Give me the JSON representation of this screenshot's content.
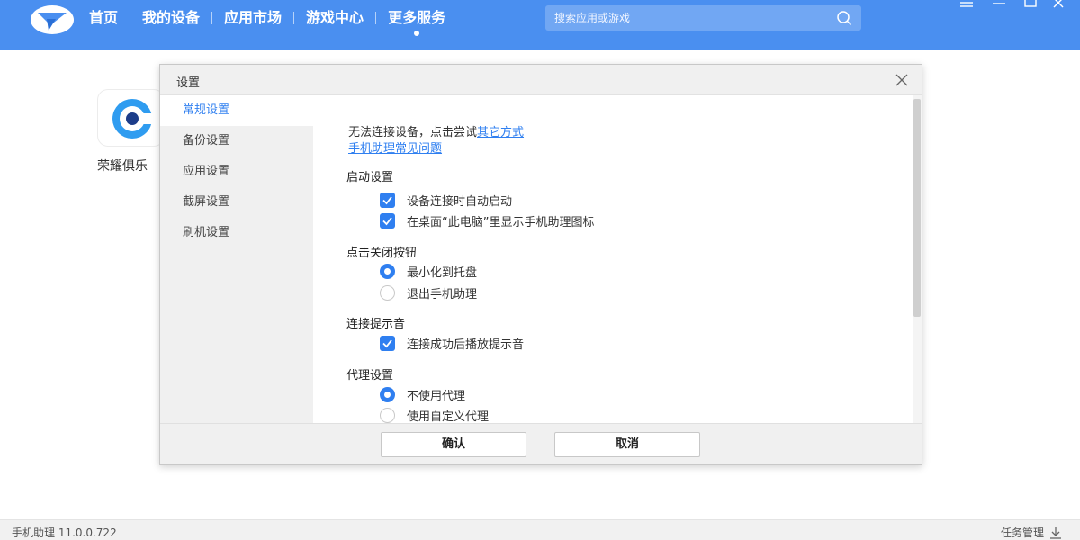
{
  "nav": {
    "items": [
      {
        "label": "首页"
      },
      {
        "label": "我的设备"
      },
      {
        "label": "应用市场"
      },
      {
        "label": "游戏中心"
      },
      {
        "label": "更多服务"
      }
    ],
    "search_placeholder": "搜索应用或游戏"
  },
  "app": {
    "label": "荣耀俱乐"
  },
  "status": {
    "version": "手机助理 11.0.0.722",
    "task_manager": "任务管理"
  },
  "dialog": {
    "title": "设置",
    "sidebar": [
      {
        "label": "常规设置"
      },
      {
        "label": "备份设置"
      },
      {
        "label": "应用设置"
      },
      {
        "label": "截屏设置"
      },
      {
        "label": "刷机设置"
      }
    ],
    "content": {
      "connect_hint_prefix": "无法连接设备，点击尝试",
      "connect_hint_link": "其它方式",
      "faq_link": "手机助理常见问题",
      "startup": {
        "heading": "启动设置",
        "options": [
          {
            "label": "设备连接时自动启动",
            "checked": true
          },
          {
            "label": "在桌面“此电脑”里显示手机助理图标",
            "checked": true
          }
        ]
      },
      "close_button": {
        "heading": "点击关闭按钮",
        "options": [
          {
            "label": "最小化到托盘",
            "selected": true
          },
          {
            "label": "退出手机助理",
            "selected": false
          }
        ]
      },
      "connect_sound": {
        "heading": "连接提示音",
        "options": [
          {
            "label": "连接成功后播放提示音",
            "checked": true
          }
        ]
      },
      "proxy": {
        "heading": "代理设置",
        "options": [
          {
            "label": "不使用代理",
            "selected": true
          },
          {
            "label": "使用自定义代理",
            "selected": false
          }
        ]
      }
    },
    "buttons": {
      "confirm": "确认",
      "cancel": "取消"
    }
  },
  "colors": {
    "topbar": "#4a8ff0",
    "accent": "#2f7ff0"
  }
}
